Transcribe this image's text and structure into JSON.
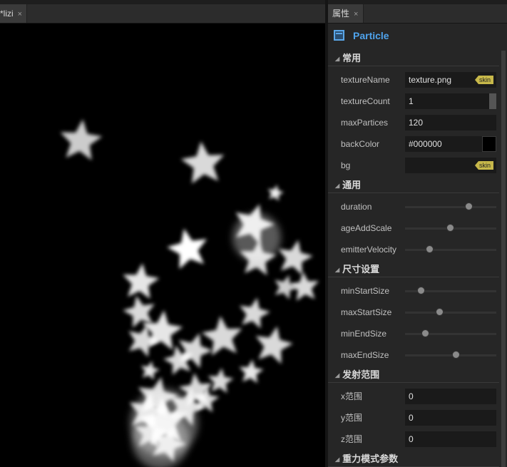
{
  "editor": {
    "tab_label": "*lizi",
    "tab_close": "×"
  },
  "canvas": {
    "background": "#000000",
    "particle_color": "#ffffff"
  },
  "panel": {
    "tab_label": "属性",
    "tab_close": "×",
    "component_icon": "panel-icon",
    "component_title": "Particle",
    "title_color": "#4fa3ec",
    "sections": {
      "common": "常用",
      "general": "通用",
      "size": "尺寸设置",
      "emit_range": "发射范围",
      "gravity": "重力模式参数"
    },
    "fields": {
      "textureName": {
        "label": "textureName",
        "value": "texture.png",
        "tag": "skin"
      },
      "textureCount": {
        "label": "textureCount",
        "value": "1"
      },
      "maxPartices": {
        "label": "maxPartices",
        "value": "120"
      },
      "backColor": {
        "label": "backColor",
        "value": "#000000",
        "swatch": "#000000"
      },
      "bg": {
        "label": "bg",
        "value": "",
        "tag": "skin"
      },
      "xRange": {
        "label": "x范围",
        "value": "0"
      },
      "yRange": {
        "label": "y范围",
        "value": "0"
      },
      "zRange": {
        "label": "z范围",
        "value": "0"
      }
    },
    "sliders": {
      "duration": {
        "label": "duration",
        "level": 0.7
      },
      "ageAddScale": {
        "label": "ageAddScale",
        "level": 0.5
      },
      "emitterVelocity": {
        "label": "emitterVelocity",
        "level": 0.27
      },
      "minStartSize": {
        "label": "minStartSize",
        "level": 0.18
      },
      "maxStartSize": {
        "label": "maxStartSize",
        "level": 0.38
      },
      "minEndSize": {
        "label": "minEndSize",
        "level": 0.23
      },
      "maxEndSize": {
        "label": "maxEndSize",
        "level": 0.56
      }
    },
    "skin_tag_color": "#c7b84a",
    "slider_thumb_color": "#8a8a8a"
  }
}
